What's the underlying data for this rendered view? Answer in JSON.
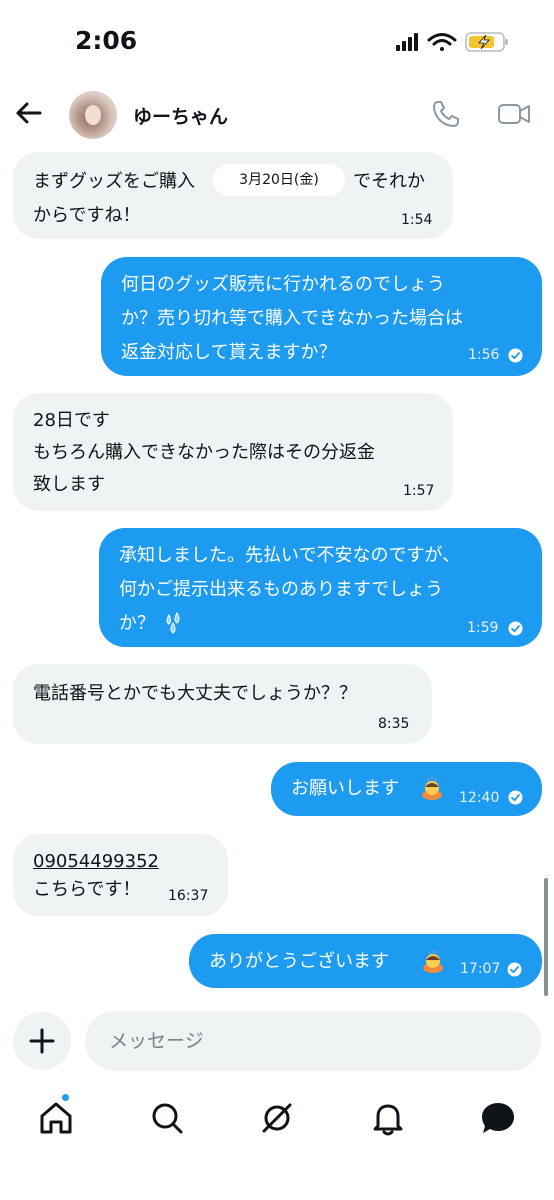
{
  "status_bar": {
    "time": "2:06"
  },
  "header": {
    "contact_name": "ゆーちゃん",
    "icons": [
      "back-arrow-icon",
      "avatar",
      "phone-icon",
      "video-icon"
    ]
  },
  "date_label": "3月20日(金)",
  "messages": [
    {
      "direction": "in",
      "lines": [
        "まずグッズをご購入",
        "からですね！"
      ],
      "tail_text": "でそれか",
      "time": "1:54"
    },
    {
      "direction": "out",
      "lines": [
        "何日のグッズ販売に行かれるのでしょう",
        "か？売り切れ等で購入できなかった場合は",
        "返金対応して貰えますか？"
      ],
      "time": "1:56",
      "read": true
    },
    {
      "direction": "in",
      "lines": [
        "28日です",
        "もちろん購入できなかった際はその分返金",
        "致します"
      ],
      "time": "1:57"
    },
    {
      "direction": "out",
      "lines": [
        "承知しました。先払いで不安なのですが、",
        "何かご提示出来るものありますでしょう",
        "か？"
      ],
      "emoji": "sweat-droplets-emoji",
      "time": "1:59",
      "read": true
    },
    {
      "direction": "in",
      "lines": [
        "電話番号とかでも大丈夫でしょうか？？"
      ],
      "time": "8:35"
    },
    {
      "direction": "out",
      "lines": [
        "お願いします"
      ],
      "emoji": "bowing-person-emoji",
      "time": "12:40",
      "read": true
    },
    {
      "direction": "in",
      "lines": [
        "09054499352",
        "こちらです！"
      ],
      "time": "16:37"
    },
    {
      "direction": "out",
      "lines": [
        "ありがとうございます"
      ],
      "emoji": "bowing-person-emoji",
      "time": "17:07",
      "read": true
    }
  ],
  "composer": {
    "placeholder": "メッセージ"
  },
  "bottom_nav": [
    "home-icon",
    "search-icon",
    "grok-icon",
    "notifications-bell-icon",
    "messages-icon"
  ],
  "colors": {
    "accent": "#1d9bf0",
    "incoming_bubble": "#eff3f4",
    "text": "#0f1419"
  }
}
